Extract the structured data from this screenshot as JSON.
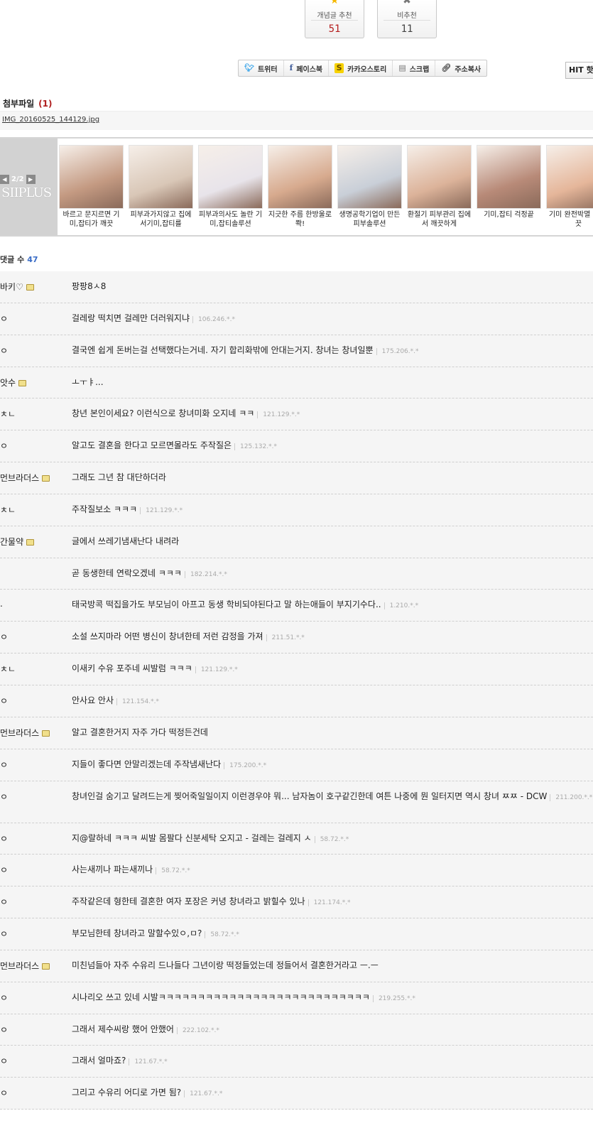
{
  "votes": {
    "up": {
      "label": "개념글 추천",
      "count": "51"
    },
    "down": {
      "label": "비추천",
      "count": "11"
    }
  },
  "share": [
    {
      "icon": "twitter-icon",
      "label": "트위터"
    },
    {
      "icon": "facebook-icon",
      "label": "페이스북"
    },
    {
      "icon": "kakaostory-icon",
      "label": "카카오스토리"
    },
    {
      "icon": "scrap-icon",
      "label": "스크랩"
    },
    {
      "icon": "link-icon",
      "label": "주소복사"
    }
  ],
  "hit_label": "HIT 핫",
  "attach": {
    "title": "첨부파일",
    "count": "(1)",
    "file": "IMG_20160525_144129.jpg"
  },
  "ad": {
    "pager": "2/2",
    "brand": "SIIPLUS",
    "items": [
      {
        "caption": "바르고 문지르면 기미,잡티가 깨끗",
        "color": "#c49a82"
      },
      {
        "caption": "피부과가지않고 집에서기미,잡티를",
        "color": "#d9c7b7"
      },
      {
        "caption": "피부과의사도 놀란 기미,잡티솔루션",
        "color": "#e8e4ea"
      },
      {
        "caption": "지긋한 주름 한방울로 쫙!",
        "color": "#d7aa8e"
      },
      {
        "caption": "생명공학기업이 만든 피부솔루션",
        "color": "#c9cfd8"
      },
      {
        "caption": "환절기 피부관리 집에서 깨끗하게",
        "color": "#dcb39a"
      },
      {
        "caption": "기미,잡티 걱정끝",
        "color": "#b88a78"
      },
      {
        "caption": "기미 완전박멸 후 깨끗",
        "color": "#e5b69a"
      }
    ]
  },
  "comments_header": {
    "label": "댓글 수",
    "count": "47"
  },
  "comments": [
    {
      "nick": "바키♡",
      "lock": true,
      "text": "팡팡8ㅅ8",
      "ip": ""
    },
    {
      "nick": "ㅇ",
      "lock": false,
      "text": "걸레랑 떡치면 걸레만 더러워지냐",
      "ip": "106.246.*.*"
    },
    {
      "nick": "ㅇ",
      "lock": false,
      "text": "결국엔 쉽게 돈버는걸 선택했다는거네. 자기 합리화밖에 안대는거지. 창녀는 창녀일뿐",
      "ip": "175.206.*.*"
    },
    {
      "nick": "앗수",
      "lock": true,
      "text": "ㅗㅜㅑ...",
      "ip": ""
    },
    {
      "nick": "ㅊㄴ",
      "lock": false,
      "text": "창년 본인이세요? 이런식으로 창녀미화 오지네 ㅋㅋ",
      "ip": "121.129.*.*"
    },
    {
      "nick": "ㅇ",
      "lock": false,
      "text": "알고도 결혼을 한다고 모르면몰라도 주작질은",
      "ip": "125.132.*.*"
    },
    {
      "nick": "먼브라더스",
      "lock": true,
      "text": "그래도 그년 참 대단하더라",
      "ip": ""
    },
    {
      "nick": "ㅊㄴ",
      "lock": false,
      "text": "주작질보소 ㅋㅋㅋ",
      "ip": "121.129.*.*"
    },
    {
      "nick": "간물약",
      "lock": true,
      "text": "글에서 쓰레기냄새난다 내려라",
      "ip": ""
    },
    {
      "nick": "",
      "lock": false,
      "text": "곧 동생한테 연락오겠네 ㅋㅋㅋ",
      "ip": "182.214.*.*"
    },
    {
      "nick": ".",
      "lock": false,
      "text": "태국방콕 떡집을가도 부모님이 아프고 동생 학비되야된다고 말 하는애들이 부지기수다..",
      "ip": "1.210.*.*"
    },
    {
      "nick": "ㅇ",
      "lock": false,
      "text": "소설 쓰지마라 어떤 병신이 창녀한테 저런 감정을 가져",
      "ip": "211.51.*.*"
    },
    {
      "nick": "ㅊㄴ",
      "lock": false,
      "text": "이새키 수유 포주네 씨발럼 ㅋㅋㅋ",
      "ip": "121.129.*.*"
    },
    {
      "nick": "ㅇ",
      "lock": false,
      "text": "안사요 안사",
      "ip": "121.154.*.*"
    },
    {
      "nick": "먼브라더스",
      "lock": true,
      "text": "알고 결혼한거지 자주 가다 떡정든건데",
      "ip": ""
    },
    {
      "nick": "ㅇ",
      "lock": false,
      "text": "지들이 좋다면 안말리겠는데 주작냄새난다",
      "ip": "175.200.*.*"
    },
    {
      "nick": "ㅇ",
      "lock": false,
      "tall": true,
      "text": "창녀인걸 숨기고 달려드는게 찢어죽일일이지 이런경우야 뭐... 남자놈이 호구같긴한데 여튼 나중에 뭔 일터지면 역시 창녀 ㅉㅉ - DCW",
      "ip": "211.200.*.*"
    },
    {
      "nick": "ㅇ",
      "lock": false,
      "text": "지@랄하네 ㅋㅋㅋ 씨발 몸팔다 신분세탁 오지고 - 걸레는 걸레지 ㅅ",
      "ip": "58.72.*.*"
    },
    {
      "nick": "ㅇ",
      "lock": false,
      "text": "사는새끼나 파는새끼나",
      "ip": "58.72.*.*"
    },
    {
      "nick": "ㅇ",
      "lock": false,
      "text": "주작같은데 형한테 결혼한 여자 포장은 커녕 창녀라고 밝힐수 있나",
      "ip": "121.174.*.*"
    },
    {
      "nick": "ㅇ",
      "lock": false,
      "text": "부모님한테 창녀라고 말할수있ㅇ,ㅁ?",
      "ip": "58.72.*.*"
    },
    {
      "nick": "먼브라더스",
      "lock": true,
      "text": "미친넘들아 자주 수유리 드나들다 그년이랑 떡정들었는데 정들어서 결혼한거라고 ㅡ.ㅡ",
      "ip": ""
    },
    {
      "nick": "ㅇ",
      "lock": false,
      "text": "시나리오 쓰고 있네 시발ㅋㅋㅋㅋㅋㅋㅋㅋㅋㅋㅋㅋㅋㅋㅋㅋㅋㅋㅋㅋㅋㅋㅋㅋㅋㅋㅋ",
      "ip": "219.255.*.*"
    },
    {
      "nick": "ㅇ",
      "lock": false,
      "text": "그래서 제수씨랑 했어 안했어",
      "ip": "222.102.*.*"
    },
    {
      "nick": "ㅇ",
      "lock": false,
      "text": "그래서 얼마죠?",
      "ip": "121.67.*.*"
    },
    {
      "nick": "ㅇ",
      "lock": false,
      "text": "그리고 수유리 어디로 가면 됨?",
      "ip": "121.67.*.*"
    }
  ]
}
